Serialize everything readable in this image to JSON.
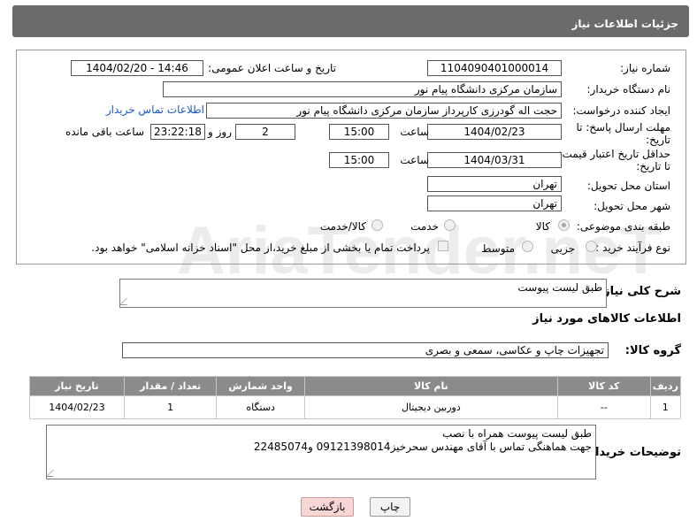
{
  "header": {
    "title": "جزئیات اطلاعات نیاز"
  },
  "fields": {
    "need_number_label": "شماره نیاز:",
    "need_number": "1104090401000014",
    "announce_label": "تاریخ و ساعت اعلان عمومی:",
    "announce_value": "1404/02/20 - 14:46",
    "buyer_org_label": "نام دستگاه خریدار:",
    "buyer_org": "سازمان مرکزی دانشگاه پیام نور",
    "creator_label": "ایجاد کننده درخواست:",
    "creator": "حجت اله گودرزی کارپرداز سازمان مرکزی دانشگاه پیام نور",
    "contact_link": "اطلاعات تماس خریدار",
    "deadline_label_1": "مهلت ارسال پاسخ: تا",
    "deadline_label_2": "تاریخ:",
    "deadline_date": "1404/02/23",
    "time_label": "ساعت",
    "deadline_time": "15:00",
    "days_value": "2",
    "days_label": "روز و",
    "remaining_value": "23:22:18",
    "remaining_label": "ساعت باقی مانده",
    "validity_label_1": "حداقل تاریخ اعتبار قیمت:",
    "validity_label_2": "تا تاریخ:",
    "validity_date": "1404/03/31",
    "validity_time": "15:00",
    "province_label": "استان محل تحویل:",
    "province": "تهران",
    "city_label": "شهر محل تحویل:",
    "city": "تهران",
    "category_label": "طبقه بندی موضوعی:",
    "category_options": [
      "کالا",
      "خدمت",
      "کالا/خدمت"
    ],
    "category_selected": "کالا",
    "process_label": "نوع فرآیند خرید :",
    "process_options": [
      "جزیی",
      "متوسط"
    ],
    "payment_note": "پرداخت تمام یا بخشی از مبلغ خرید،از محل \"اسناد خزانه اسلامی\" خواهد بود."
  },
  "description": {
    "label": "شرح کلی نیاز:",
    "value": "طبق لیست پیوست"
  },
  "goods": {
    "section_title": "اطلاعات کالاهای مورد نیاز",
    "group_label": "گروه کالا:",
    "group_value": "تجهیزات چاپ و عکاسی، سمعی و بصری",
    "columns": [
      "ردیف",
      "کد کالا",
      "نام کالا",
      "واحد شمارش",
      "تعداد / مقدار",
      "تاریخ نیاز"
    ],
    "rows": [
      [
        "1",
        "--",
        "دوربین دیجیتال",
        "دستگاه",
        "1",
        "1404/02/23"
      ]
    ]
  },
  "buyer_notes": {
    "label": "توضیحات خریدار:",
    "line1": "طبق لیست پیوست همراه با نصب",
    "line2": "جهت هماهنگی تماس با آقای مهندس سحرخیز09121398014 و22485074"
  },
  "buttons": {
    "print": "چاپ",
    "back": "بازگشت"
  },
  "watermark": "AriaTender.neT"
}
